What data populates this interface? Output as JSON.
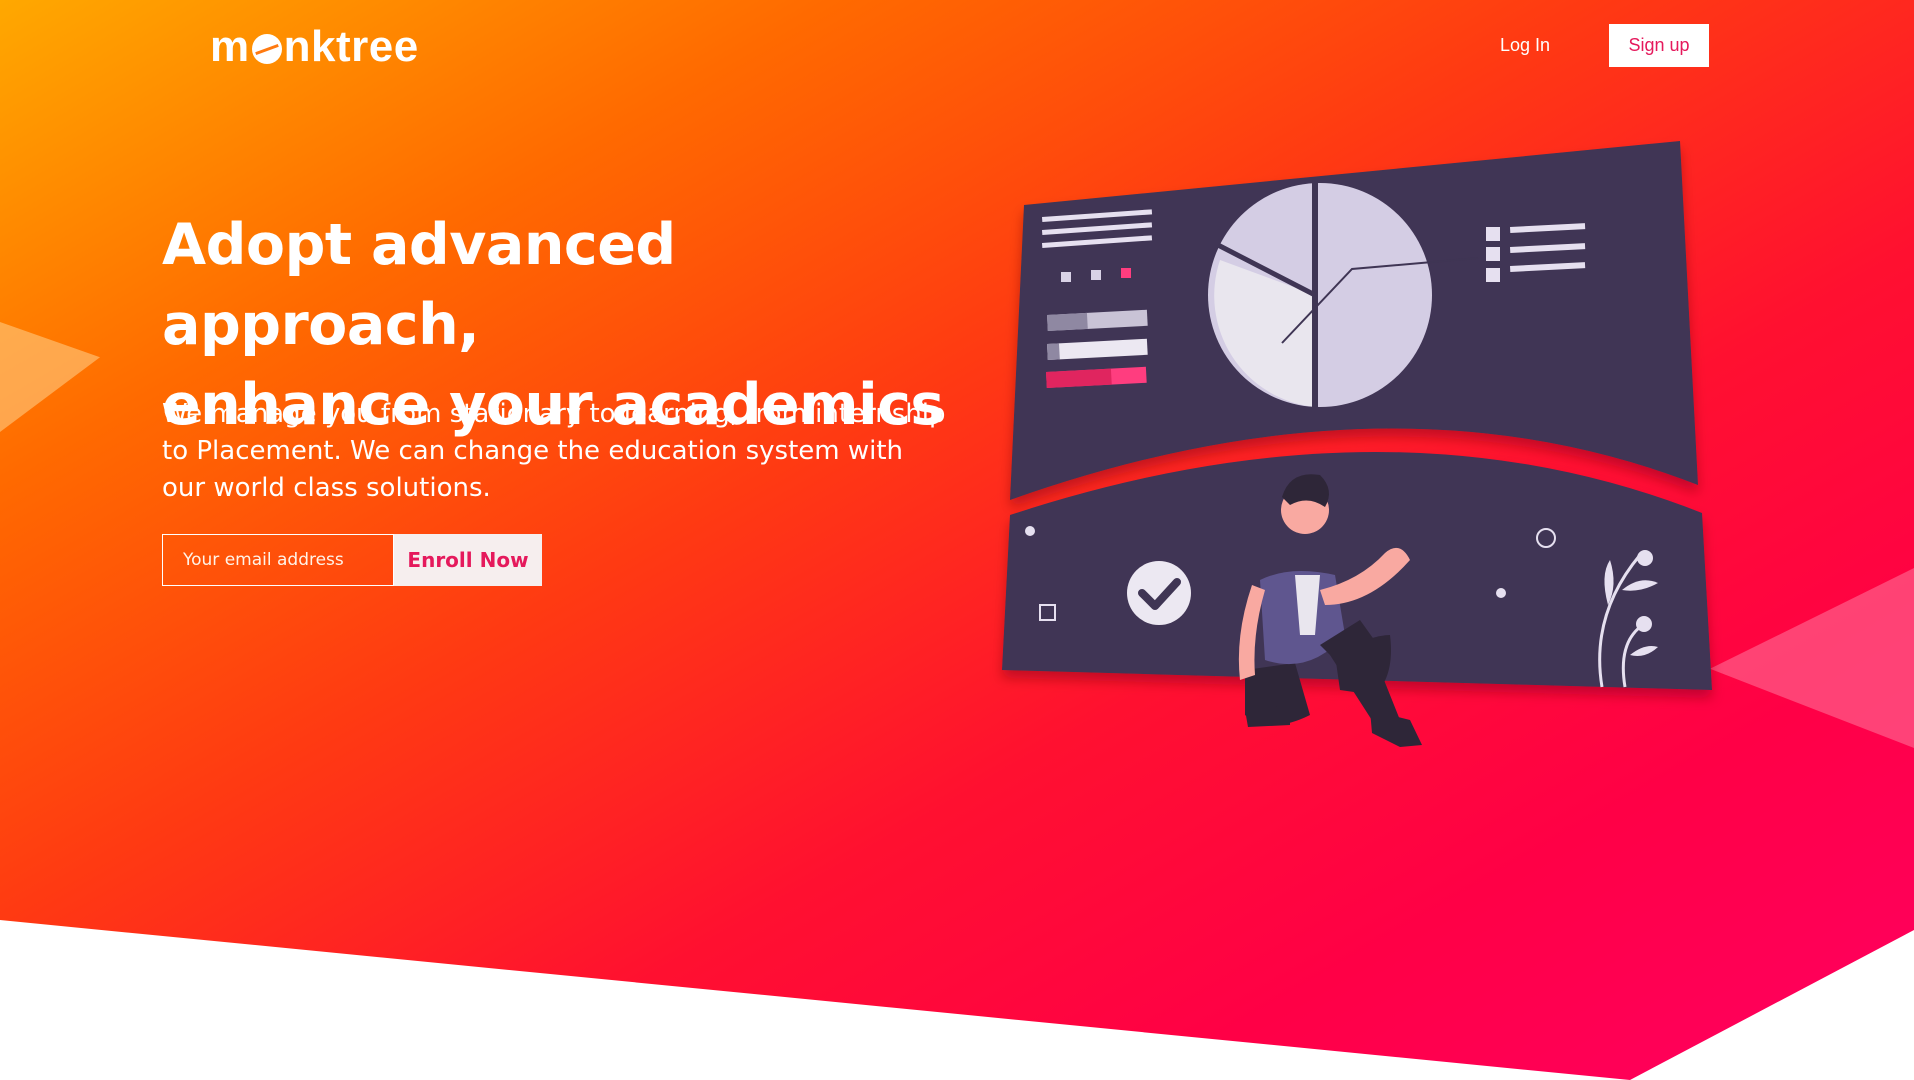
{
  "brand": {
    "name": "monktree",
    "name_prefix": "m",
    "name_suffix": "nktree"
  },
  "nav": {
    "login_label": "Log In",
    "signup_label": "Sign up"
  },
  "hero": {
    "headline_line1": "Adopt advanced approach,",
    "headline_line2": "enhance your academics",
    "description": "We manage you from stationary to learning, from internship to Placement. We can change the education system with our world class solutions.",
    "email_placeholder": "Your email address",
    "enroll_label": "Enroll Now"
  },
  "colors": {
    "accent": "#e5195c",
    "gradient_start": "#ffa800",
    "gradient_end": "#ff0062",
    "panel": "#3f3554"
  },
  "icons": {
    "illustration": "dashboard-person-illustration",
    "check": "check-icon",
    "pie": "pie-chart-icon"
  }
}
